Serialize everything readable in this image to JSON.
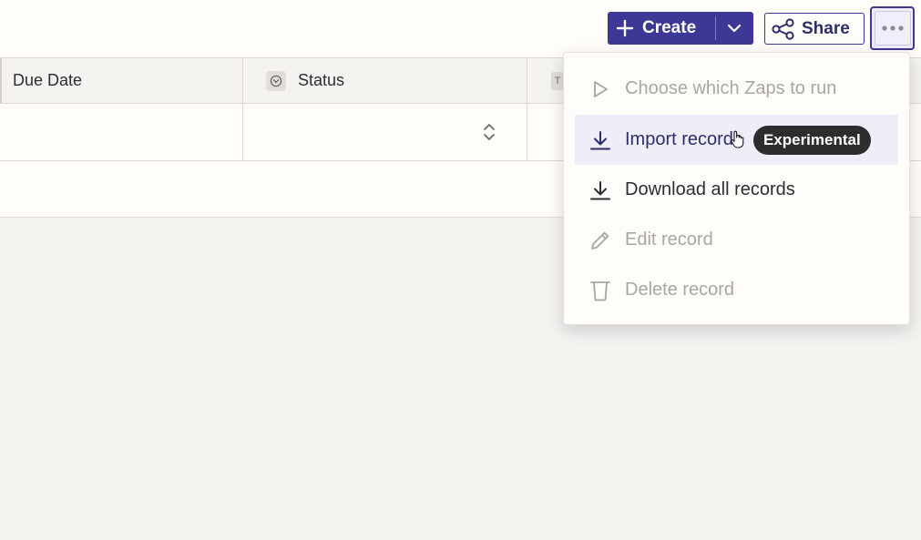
{
  "toolbar": {
    "create_label": "Create",
    "share_label": "Share"
  },
  "table": {
    "columns": [
      {
        "label": "Due Date"
      },
      {
        "label": "Status"
      },
      {
        "label": "T"
      }
    ]
  },
  "menu": {
    "items": [
      {
        "label": "Choose which Zaps to run",
        "icon": "play-icon",
        "enabled": false
      },
      {
        "label": "Import records",
        "icon": "download-icon",
        "enabled": true,
        "badge": "Experimental",
        "hovered": true
      },
      {
        "label": "Download all records",
        "icon": "download-icon",
        "enabled": true
      },
      {
        "label": "Edit record",
        "icon": "pencil-icon",
        "enabled": false
      },
      {
        "label": "Delete record",
        "icon": "trash-icon",
        "enabled": false
      }
    ]
  },
  "colors": {
    "primary": "#3d3896",
    "hover_bg": "#eeedf8",
    "badge_bg": "#2d2d2d",
    "disabled_text": "#a8a6a2"
  }
}
